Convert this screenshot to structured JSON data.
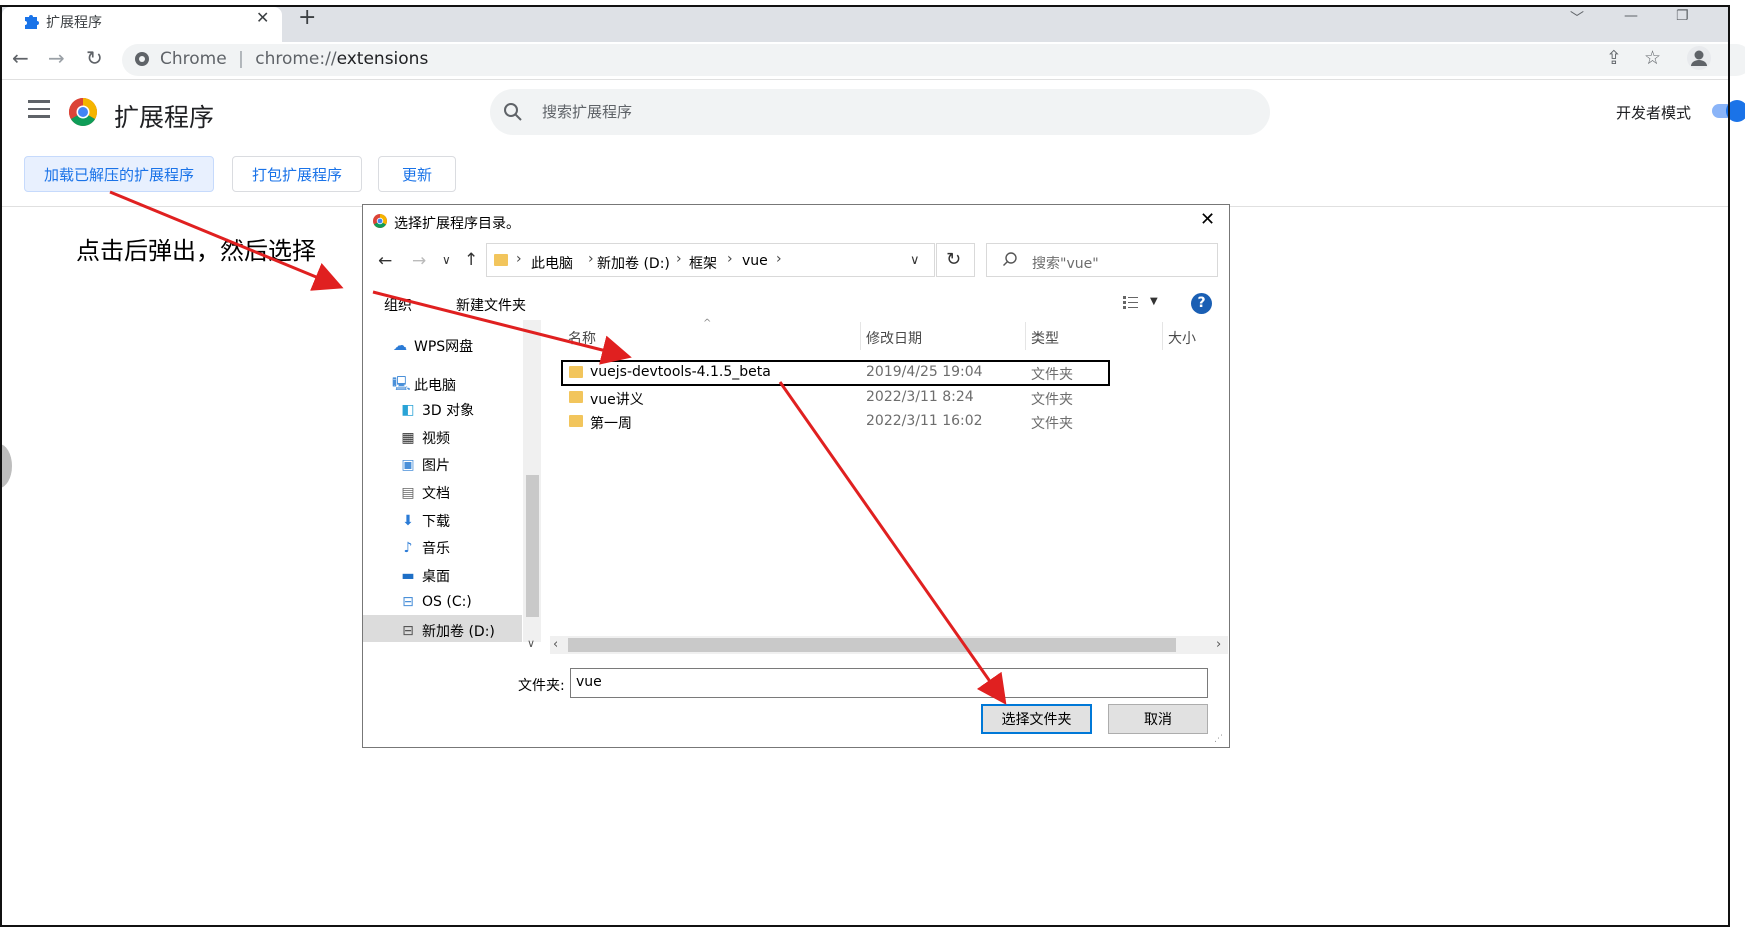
{
  "browser": {
    "tab_title": "扩展程序",
    "tab_close": "✕",
    "new_tab": "+",
    "omnibox_site": "Chrome",
    "omnibox_sep": "|",
    "omnibox_scheme": "chrome://",
    "omnibox_path": "extensions"
  },
  "page": {
    "title": "扩展程序",
    "search_placeholder": "搜索扩展程序",
    "developer_mode_label": "开发者模式",
    "developer_mode_on": true,
    "buttons": {
      "load_unpacked": "加载已解压的扩展程序",
      "pack": "打包扩展程序",
      "update": "更新"
    }
  },
  "annotation": "点击后弹出，然后选择",
  "dialog": {
    "title": "选择扩展程序目录。",
    "breadcrumb": [
      "此电脑",
      "新加卷 (D:)",
      "框架",
      "vue"
    ],
    "search_placeholder": "搜索\"vue\"",
    "toolbar": {
      "organize": "组织",
      "new_folder": "新建文件夹"
    },
    "help": "?",
    "nav_items": [
      {
        "label": "WPS网盘",
        "icon": "cloud-icon"
      },
      {
        "label": "此电脑",
        "icon": "computer-icon"
      },
      {
        "label": "3D 对象",
        "icon": "cube-icon"
      },
      {
        "label": "视频",
        "icon": "film-icon"
      },
      {
        "label": "图片",
        "icon": "picture-icon"
      },
      {
        "label": "文档",
        "icon": "document-icon"
      },
      {
        "label": "下载",
        "icon": "download-icon"
      },
      {
        "label": "音乐",
        "icon": "music-icon"
      },
      {
        "label": "桌面",
        "icon": "desktop-icon"
      },
      {
        "label": "OS (C:)",
        "icon": "drive-icon"
      },
      {
        "label": "新加卷 (D:)",
        "icon": "drive-icon",
        "selected": true
      }
    ],
    "columns": {
      "name": "名称",
      "modified": "修改日期",
      "type": "类型",
      "size": "大小"
    },
    "rows": [
      {
        "name": "vuejs-devtools-4.1.5_beta",
        "modified": "2019/4/25 19:04",
        "type": "文件夹"
      },
      {
        "name": "vue讲义",
        "modified": "2022/3/11 8:24",
        "type": "文件夹"
      },
      {
        "name": "第一周",
        "modified": "2022/3/11 16:02",
        "type": "文件夹"
      }
    ],
    "folder_label": "文件夹:",
    "folder_value": "vue",
    "select_button": "选择文件夹",
    "cancel_button": "取消"
  },
  "colors": {
    "accent": "#1a73e8",
    "arrow": "#e02020",
    "folder": "#f2c55c"
  }
}
